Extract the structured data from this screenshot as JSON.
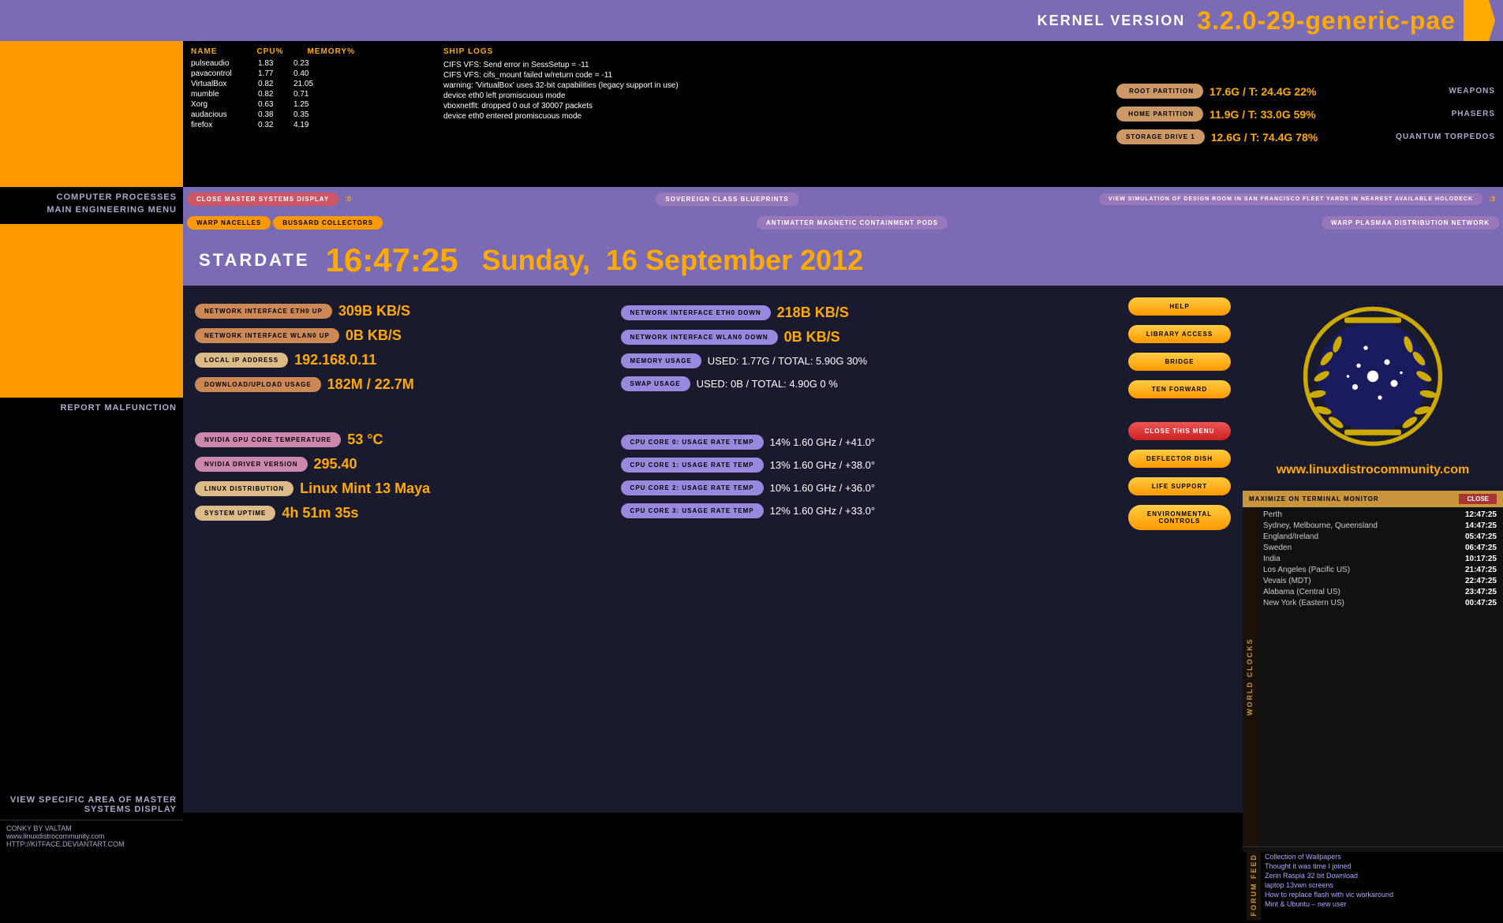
{
  "header": {
    "kernel_label": "KERNEL VERSION",
    "kernel_version": "3.2.0-29-generic-pae"
  },
  "processes": {
    "columns": [
      "NAME",
      "CPU%",
      "MEMORY%"
    ],
    "rows": [
      {
        "name": "pulseaudio",
        "cpu": "1.83",
        "mem": "0.23"
      },
      {
        "name": "pavacontrol",
        "cpu": "1.77",
        "mem": "0.40"
      },
      {
        "name": "VirtualBox",
        "cpu": "0.82",
        "mem": "21.05"
      },
      {
        "name": "mumble",
        "cpu": "0.82",
        "mem": "0.71"
      },
      {
        "name": "Xorg",
        "cpu": "0.63",
        "mem": "1.25"
      },
      {
        "name": "audacious",
        "cpu": "0.38",
        "mem": "0.35"
      },
      {
        "name": "firefox",
        "cpu": "0.32",
        "mem": "4.19"
      }
    ],
    "section_label": "COMPUTER PROCESSES",
    "menu_label": "MAIN ENGINEERING MENU"
  },
  "ship_logs": {
    "title": "SHIP LOGS",
    "entries": [
      "CIFS VFS: Send error in SessSetup = -11",
      "CIFS VFS: cifs_mount failed w/return code = -11",
      "warning: 'VirtualBox' uses 32-bit capabilities (legacy support in use)",
      "device eth0 left promiscuous mode",
      "vboxnetflt: dropped 0 out of 30007 packets",
      "device eth0 entered promiscuous mode"
    ]
  },
  "partitions": [
    {
      "label": "ROOT PARTITION",
      "value": "17.6G / T: 24.4G 22%",
      "name": "WEAPONS"
    },
    {
      "label": "HOME PARTITION",
      "value": "11.9G / T: 33.0G 59%",
      "name": "PHASERS"
    },
    {
      "label": "STORAGE DRIVE 1",
      "value": "12.6G / T: 74.4G 78%",
      "name": "QUANTUM TORPEDOS"
    }
  ],
  "nav1": {
    "btn1": "CLOSE MASTER SYSTEMS DISPLAY",
    "num1": ":0",
    "btn2": "SOVEREIGN CLASS BLUEPRINTS",
    "btn3": "VIEW SIMULATION OF DESIGN ROOM IN SAN FRANCISCO FLEET YARDS IN NEAREST AVAILABLE HOLODECK",
    "num2": ":3"
  },
  "nav2": {
    "btn1": "WARP NACELLES",
    "btn2": "BUSSARD COLLECTORS",
    "btn3": "ANTIMATTER MAGNETIC CONTAINMENT PODS",
    "btn4": "WARP PLASMAA DISTRIBUTION NETWORK"
  },
  "stardate": {
    "label": "STARDATE",
    "time": "16:47:25",
    "day": "Sunday,",
    "date": "16 September 2012"
  },
  "metrics": {
    "left_col": [
      {
        "label": "NETWORK INTERFACE ETH0 UP",
        "value": "309B KB/S"
      },
      {
        "label": "NETWORK INTERFACE WLAN0 UP",
        "value": "0B  KB/S"
      },
      {
        "label": "LOCAL IP ADDRESS",
        "value": "192.168.0.11"
      },
      {
        "label": "DOWNLOAD/UPLOAD USAGE",
        "value": "182M / 22.7M"
      }
    ],
    "mid_col": [
      {
        "label": "NETWORK INTERFACE ETH0 DOWN",
        "value": "218B KB/S"
      },
      {
        "label": "NETWORK INTERFACE WLAN0 DOWN",
        "value": "0B  KB/S"
      },
      {
        "label": "MEMORY USAGE",
        "value": "USED: 1.77G / TOTAL: 5.90G  30%"
      },
      {
        "label": "SWAP USAGE",
        "value": "USED: 0B  / TOTAL: 4.90G   0 %"
      }
    ],
    "right_btns": [
      "HELP",
      "LIBRARY ACCESS",
      "BRIDGE",
      "TEN FORWARD"
    ],
    "lower_left": [
      {
        "label": "NVIDIA GPU CORE TEMPERATURE",
        "value": "53 °C"
      },
      {
        "label": "NVIDIA DRIVER VERSION",
        "value": "295.40"
      },
      {
        "label": "LINUX DISTRIBUTION",
        "value": "Linux Mint 13 Maya"
      },
      {
        "label": "SYSTEM UPTIME",
        "value": "4h 51m 35s"
      }
    ],
    "lower_mid": [
      {
        "label": "CPU CORE 0: USAGE RATE TEMP",
        "value": "14% 1.60 GHz /  +41.0°"
      },
      {
        "label": "CPU CORE 1: USAGE RATE TEMP",
        "value": "13% 1.60 GHz /  +38.0°"
      },
      {
        "label": "CPU CORE 2: USAGE RATE TEMP",
        "value": "10% 1.60 GHz /  +36.0°"
      },
      {
        "label": "CPU CORE 3: USAGE RATE TEMP",
        "value": "12% 1.60 GHz /  +33.0°"
      }
    ],
    "lower_right_btns": [
      "CLOSE THIS MENU",
      "DEFLECTOR DISH",
      "LIFE SUPPORT",
      "ENVIRONMENTAL CONTROLS"
    ]
  },
  "world_clocks": {
    "title": "WORLD CLOCKS",
    "header_btn1": "MAXIMIZE ON TERMINAL MONITOR",
    "header_btn2": "CLOSE",
    "clocks": [
      {
        "city": "Perth",
        "time": "12:47:25"
      },
      {
        "city": "Sydney, Melbourne, Queensland",
        "time": "14:47:25"
      },
      {
        "city": "England/Ireland",
        "time": "05:47:25"
      },
      {
        "city": "Sweden",
        "time": "06:47:25"
      },
      {
        "city": "India",
        "time": "10:17:25"
      },
      {
        "city": "Los Angeles (Pacific US)",
        "time": "21:47:25"
      },
      {
        "city": "Vevais (MDT)",
        "time": "22:47:25"
      },
      {
        "city": "Alabama (Central US)",
        "time": "23:47:25"
      },
      {
        "city": "New York (Eastern US)",
        "time": "00:47:25"
      }
    ],
    "forum_feed": {
      "title": "FORUM FEED",
      "items": [
        "Collection of Wallpapers",
        "Thought it was time I joined",
        "Zerin Raspia 32 bit Download",
        "laptop 13vwn screens",
        "How to replace flash with vic workaround",
        "Mint & Ubuntu - new user"
      ]
    }
  },
  "left_sidebar": {
    "computer_processes_label": "COMPUTER PROCESSES",
    "main_menu_label": "MAIN ENGINEERING MENU",
    "report_label": "REPORT MALFUNCTION",
    "view_label": "VIEW SPECIFIC AREA OF MASTER SYSTEMS DISPLAY",
    "conky_label": "CONKY BY VALTAM",
    "website1": "www.linuxdistrocommunity.com",
    "website2": "HTTP://KITFACE.DEVIANTART.COM"
  },
  "logo": {
    "website": "www.linuxdistrocommunity.com"
  }
}
